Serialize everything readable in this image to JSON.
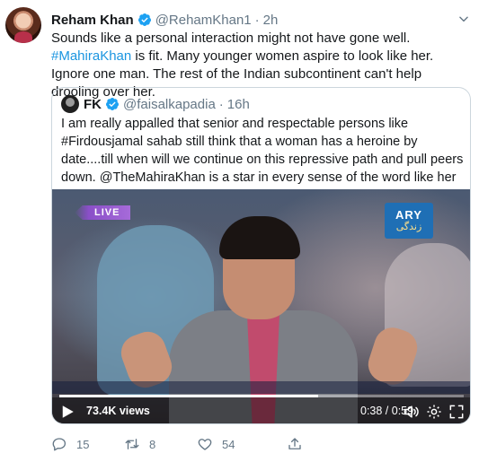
{
  "tweet": {
    "author_name": "Reham Khan",
    "author_handle": "@RehamKhan1",
    "separator": "·",
    "time": "2h",
    "text_before": "Sounds like a personal interaction might not have gone well. ",
    "hashtag": "#MahiraKhan",
    "text_after": " is fit. Many younger women aspire to look like her. Ignore one man. The rest of the Indian subcontinent can't help drooling over her."
  },
  "quoted_tweet": {
    "author_name": "FK",
    "author_handle": "@faisalkapadia",
    "separator": "·",
    "time": "16h",
    "text": "I am really appalled that senior and respectable persons like #Firdousjamal sahab still think that a woman has a heroine by date....till when will we continue on this repressive path and pull peers down. @TheMahiraKhan is a star in every sense of the word like her or hate her."
  },
  "video": {
    "live_label": "LIVE",
    "channel_name": "ARY",
    "channel_sub": "زندگی",
    "views": "73.4K views",
    "timecode": "0:38 / 0:59",
    "progress": 0.64
  },
  "actions": {
    "reply_count": "15",
    "retweet_count": "8",
    "like_count": "54"
  },
  "colors": {
    "accent": "#1b95e0",
    "verified": "#1da1f2",
    "muted": "#657786",
    "border": "#ccd6dd"
  },
  "icons": [
    "verified-badge-icon",
    "chevron-down-icon",
    "play-icon",
    "volume-icon",
    "settings-icon",
    "fullscreen-icon",
    "reply-icon",
    "retweet-icon",
    "like-icon",
    "share-icon"
  ]
}
